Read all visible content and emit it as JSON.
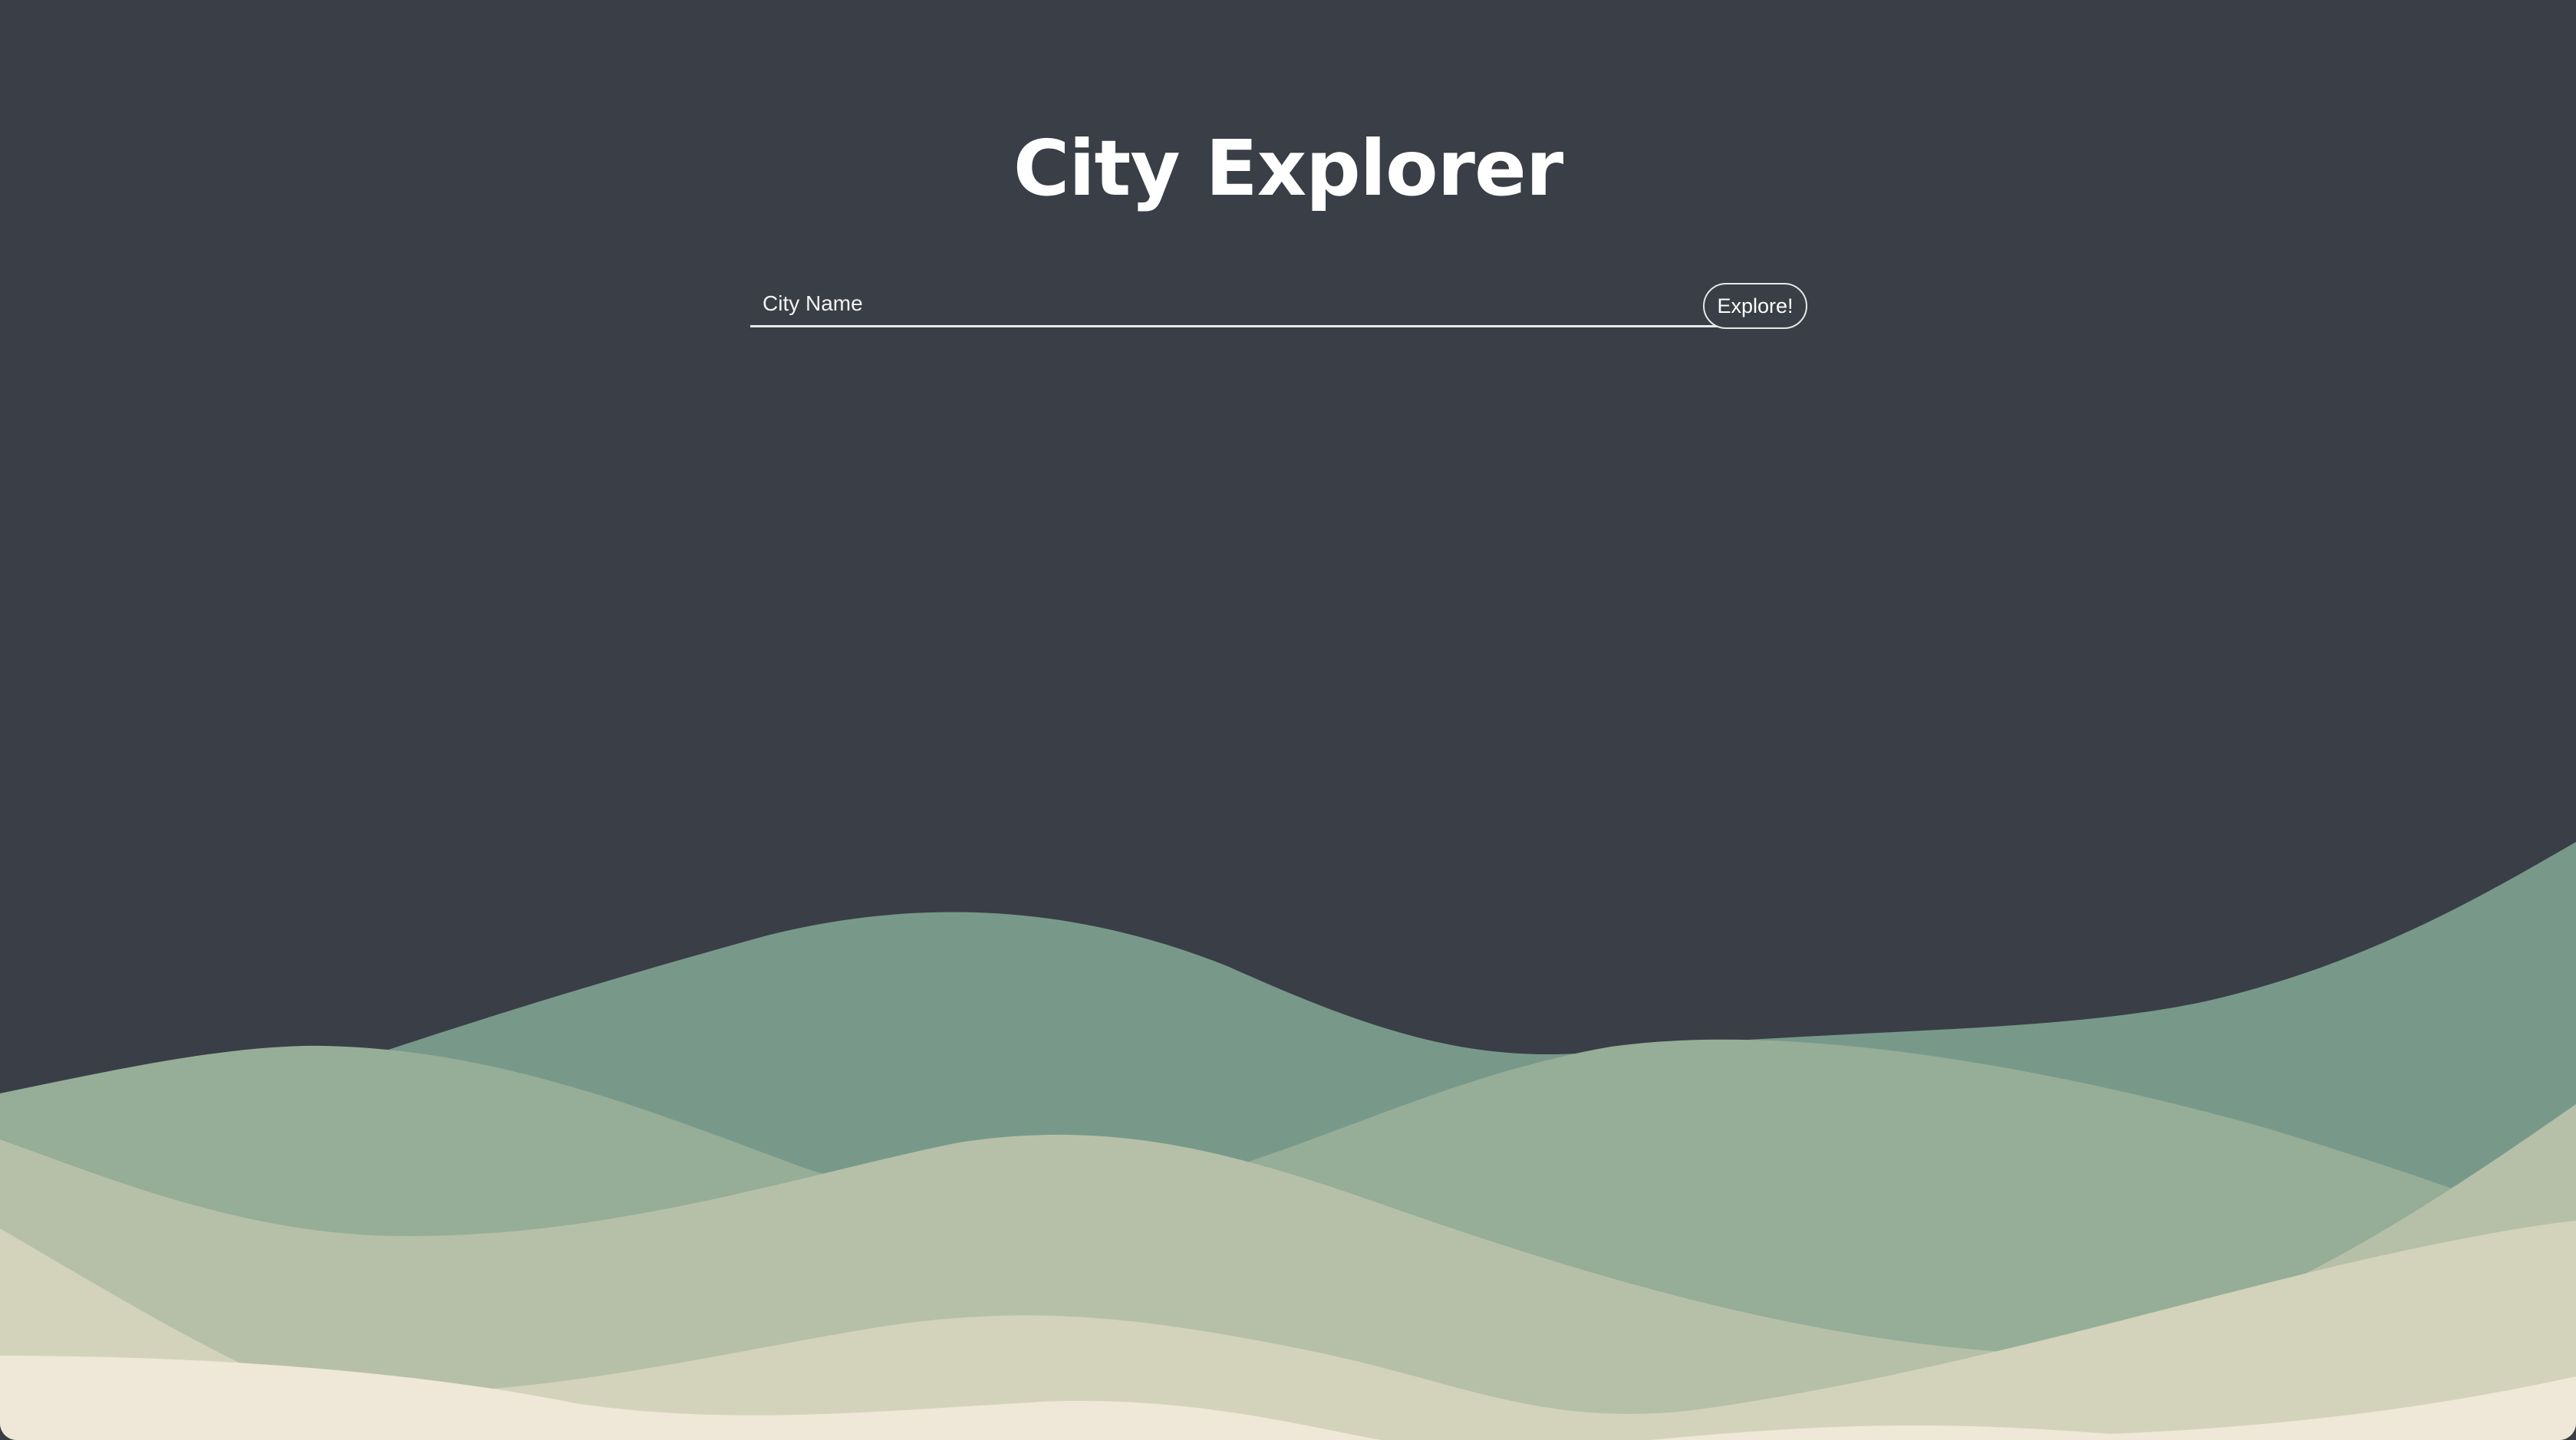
{
  "app": {
    "title": "City Explorer"
  },
  "search": {
    "placeholder": "City Name",
    "value": "",
    "button_label": "Explore!"
  },
  "colors": {
    "background": "#3a3e46",
    "wave_teal": "#78998a",
    "wave_sage": "#96ad97",
    "wave_olive": "#b6c0a8",
    "wave_sand": "#d3d2bb",
    "wave_cream": "#efe7d8"
  }
}
